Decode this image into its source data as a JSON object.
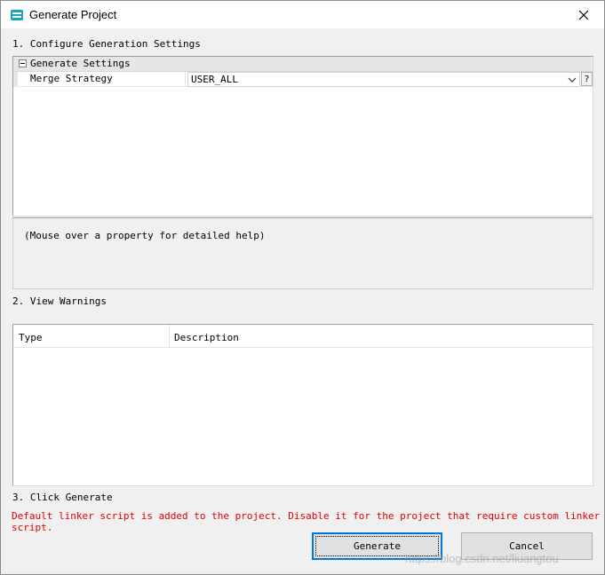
{
  "window": {
    "title": "Generate Project",
    "close_icon": "close-icon",
    "app_icon": "app-icon"
  },
  "section1": {
    "label": "1. Configure Generation Settings",
    "category_label": "Generate Settings",
    "property_name": "Merge Strategy",
    "property_value": "USER_ALL",
    "help_button": "?",
    "help_text": "(Mouse over a property for detailed help)"
  },
  "section2": {
    "label": "2. View Warnings",
    "columns": [
      "Type",
      "Description"
    ],
    "rows": []
  },
  "section3": {
    "label": "3. Click Generate",
    "message": "Default linker script is added to the project. Disable it for the project that require custom linker script.",
    "message_color": "#e00000"
  },
  "buttons": {
    "generate": "Generate",
    "cancel": "Cancel"
  },
  "watermark": "https://blog.csdn.net/liuangtou",
  "colors": {
    "accent": "#0078d7",
    "window_bg": "#f0f0f0"
  }
}
